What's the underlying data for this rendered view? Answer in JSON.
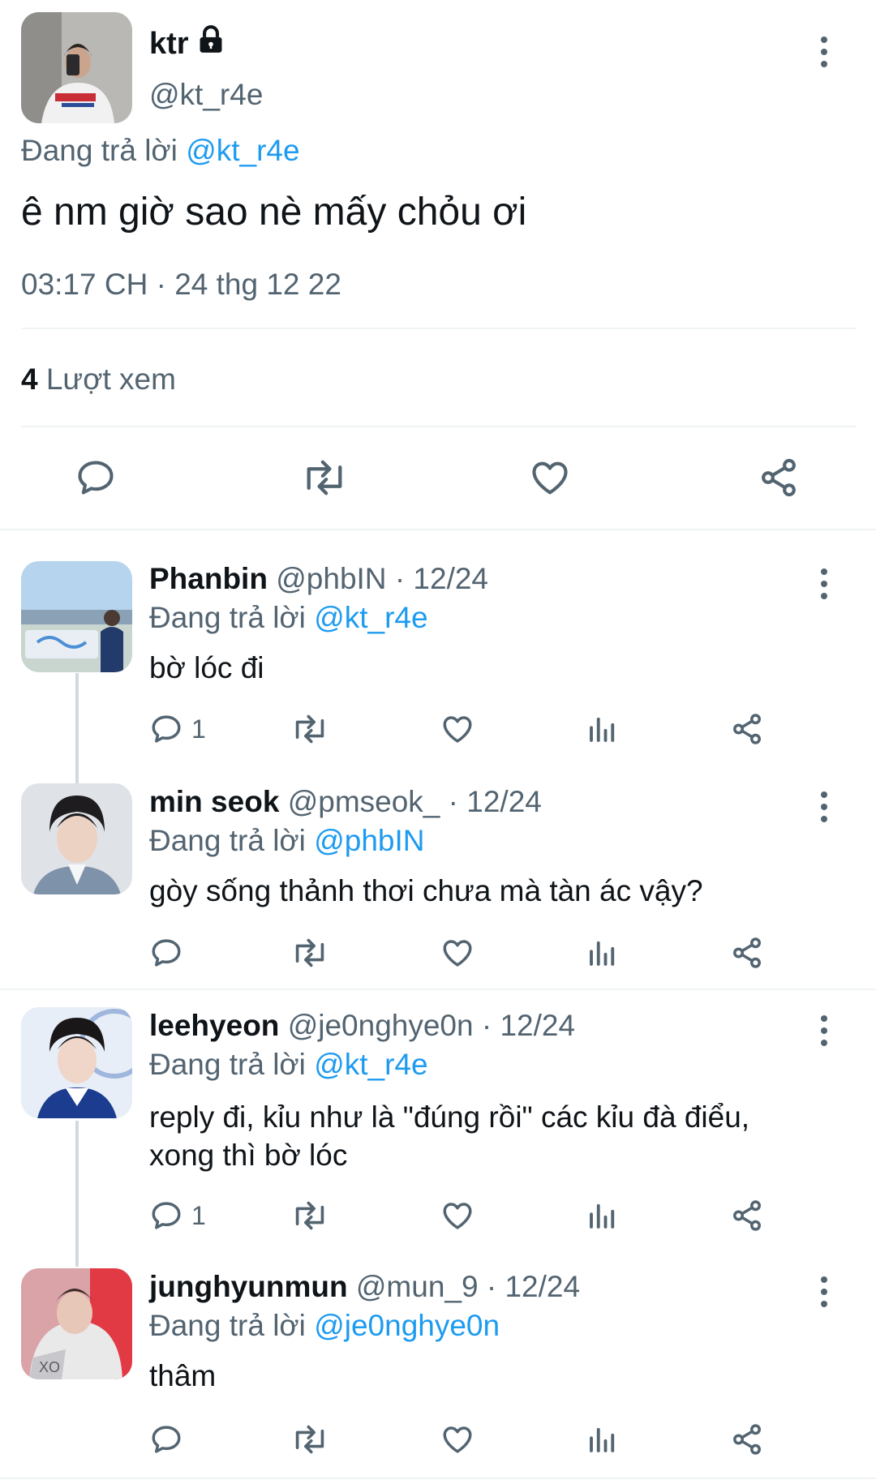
{
  "main_tweet": {
    "name": "ktr",
    "handle": "@kt_r4e",
    "reply_prefix": "Đang trả lời",
    "reply_to": "@kt_r4e",
    "text": "ê nm giờ sao nè mấy chỏu ơi",
    "time": "03:17 CH · 24 thg 12 22",
    "views_count": "4",
    "views_label": "Lượt xem",
    "avatar_icon": "person-avatar",
    "lock_icon": "lock-icon"
  },
  "replies": [
    {
      "name": "Phanbin",
      "handle": "@phbIN",
      "date": "· 12/24",
      "reply_prefix": "Đang trả lời",
      "reply_to": "@kt_r4e",
      "text": "bờ lóc đi",
      "reply_count": "1"
    },
    {
      "name": "min seok",
      "handle": "@pmseok_",
      "date": "· 12/24",
      "reply_prefix": "Đang trả lời",
      "reply_to": "@phbIN",
      "text": "gòy sống thảnh thơi chưa mà tàn ác vậy?",
      "reply_count": ""
    },
    {
      "name": "leehyeon",
      "handle": "@je0nghye0n",
      "date": "· 12/24",
      "reply_prefix": "Đang trả lời",
      "reply_to": "@kt_r4e",
      "text": "reply đi, kỉu như là \"đúng rồi\" các kỉu đà điểu, xong thì bờ lóc",
      "reply_count": "1"
    },
    {
      "name": "junghyunmun",
      "handle": "@mun_9",
      "date": "· 12/24",
      "reply_prefix": "Đang trả lời",
      "reply_to": "@je0nghye0n",
      "text": "thâm",
      "reply_count": ""
    }
  ],
  "colors": {
    "accent": "#1d9bf0",
    "secondary_text": "#536471",
    "divider": "#eff3f4"
  }
}
